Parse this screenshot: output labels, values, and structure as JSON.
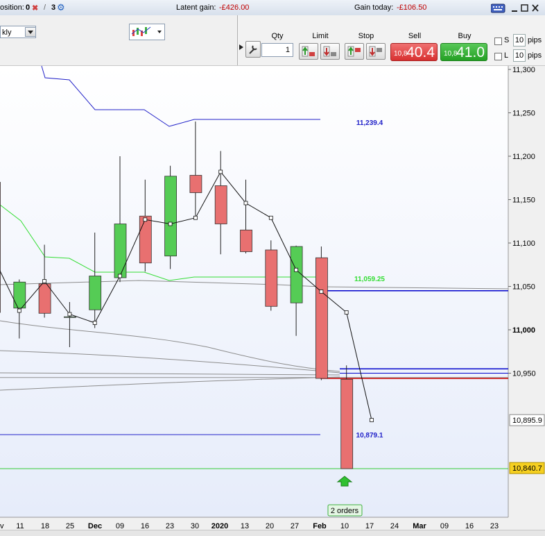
{
  "topbar": {
    "position_label": "osition:",
    "position_value": "0",
    "count": "3",
    "latent_label": "Latent gain:",
    "latent_value": "-£426.00",
    "gain_today_label": "Gain today:",
    "gain_today_value": "-£106.50"
  },
  "toolbar": {
    "period": "kly"
  },
  "order": {
    "qty_label": "Qty",
    "qty_value": "1",
    "limit_label": "Limit",
    "stop_label": "Stop",
    "sell_label": "Sell",
    "buy_label": "Buy",
    "sell_prefix": "10,8",
    "sell_big": "40.4",
    "buy_prefix": "10,8",
    "buy_big": "41.0",
    "s_label": "S",
    "l_label": "L",
    "s_pips": "10",
    "l_pips": "10",
    "pips_label": "pips"
  },
  "colors": {
    "up": "#55cc55",
    "down": "#e87070",
    "band_blue": "#2020c8",
    "band_green": "#33dd33",
    "ma_gray": "#8c8c8c",
    "ref_blue": "#0000cc",
    "ref_red": "#cc0000",
    "ref_green": "#33cc33"
  },
  "chart_data": {
    "type": "candlestick",
    "x_labels": [
      "v",
      "11",
      "18",
      "25",
      "Dec",
      "09",
      "16",
      "23",
      "30",
      "2020",
      "13",
      "20",
      "27",
      "Feb",
      "10",
      "17",
      "24",
      "Mar",
      "09",
      "16",
      "23"
    ],
    "y_ticks": [
      "11,300",
      "11,250",
      "11,200",
      "11,150",
      "11,100",
      "11,050",
      "11,000",
      "10,950"
    ],
    "y_range": [
      10800,
      11310
    ],
    "candles": [
      {
        "o": 11170,
        "h": 11200,
        "l": 11020,
        "c": 11020
      },
      {
        "o": 11025,
        "h": 11058,
        "l": 10990,
        "c": 11055
      },
      {
        "o": 11053,
        "h": 11098,
        "l": 11014,
        "c": 11019
      },
      {
        "o": 11015,
        "h": 11032,
        "l": 10980,
        "c": 11015
      },
      {
        "o": 11023,
        "h": 11112,
        "l": 11002,
        "c": 11062
      },
      {
        "o": 11060,
        "h": 11200,
        "l": 11055,
        "c": 11122
      },
      {
        "o": 11131,
        "h": 11173,
        "l": 11067,
        "c": 11077
      },
      {
        "o": 11085,
        "h": 11189,
        "l": 11070,
        "c": 11177
      },
      {
        "o": 11178,
        "h": 11240,
        "l": 11128,
        "c": 11158
      },
      {
        "o": 11166,
        "h": 11206,
        "l": 11087,
        "c": 11122
      },
      {
        "o": 11115,
        "h": 11173,
        "l": 11088,
        "c": 11090
      },
      {
        "o": 11092,
        "h": 11103,
        "l": 11022,
        "c": 11027
      },
      {
        "o": 11031,
        "h": 11097,
        "l": 10993,
        "c": 11096
      },
      {
        "o": 11083,
        "h": 11096,
        "l": 10942,
        "c": 10944
      },
      {
        "o": 10943,
        "h": 10959,
        "l": 10840,
        "c": 10840
      }
    ],
    "close_line": [
      11082,
      11022,
      11056,
      11018,
      11008,
      11062,
      11127,
      11122,
      11129,
      11182,
      11146,
      11129,
      11069,
      11044,
      11020,
      10896
    ],
    "annotations": [
      {
        "value": 11239.4,
        "text": "11,239.4"
      },
      {
        "value": 11059.25,
        "text": "11,059.25"
      },
      {
        "value": 10879.1,
        "text": "10,879.1"
      }
    ],
    "price_tags": [
      {
        "value": 10895.9,
        "text": "10,895.9"
      },
      {
        "value": 10840.7,
        "text": "10,840.7"
      }
    ],
    "orders_label": "2 orders"
  }
}
